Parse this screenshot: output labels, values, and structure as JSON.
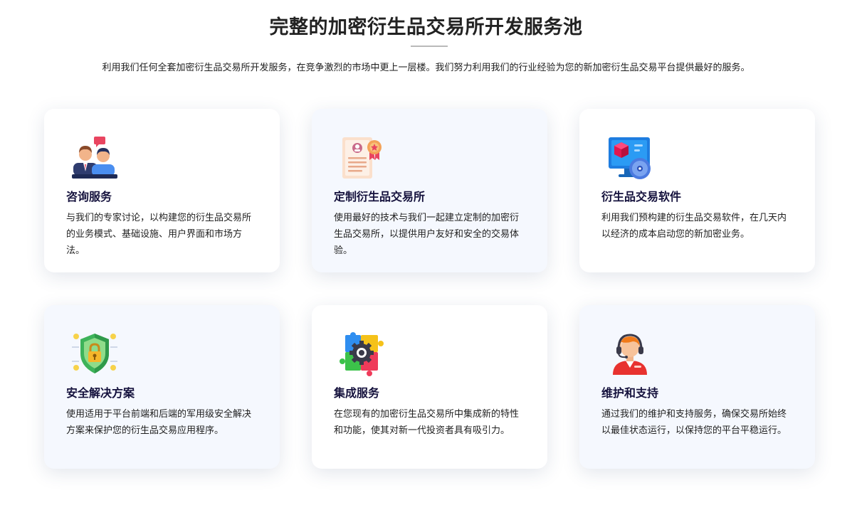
{
  "heading": "完整的加密衍生品交易所开发服务池",
  "intro": "利用我们任何全套加密衍生品交易所开发服务，在竞争激烈的市场中更上一层楼。我们努力利用我们的行业经验为您的新加密衍生品交易平台提供最好的服务。",
  "cards": [
    {
      "icon": "consulting-people-icon",
      "title": "咨询服务",
      "desc": "与我们的专家讨论，以构建您的衍生品交易所的业务模式、基础设施、用户界面和市场方法。"
    },
    {
      "icon": "certificate-badge-icon",
      "title": "定制衍生品交易所",
      "desc": "使用最好的技术与我们一起建立定制的加密衍生品交易所，以提供用户友好和安全的交易体验。"
    },
    {
      "icon": "software-monitor-icon",
      "title": "衍生品交易软件",
      "desc": "利用我们预构建的衍生品交易软件，在几天内以经济的成本启动您的新加密业务。"
    },
    {
      "icon": "security-shield-lock-icon",
      "title": "安全解决方案",
      "desc": "使用适用于平台前端和后端的军用级安全解决方案来保护您的衍生品交易应用程序。"
    },
    {
      "icon": "integration-puzzle-gear-icon",
      "title": "集成服务",
      "desc": "在您现有的加密衍生品交易所中集成新的特性和功能，使其对新一代投资者具有吸引力。"
    },
    {
      "icon": "support-headset-agent-icon",
      "title": "维护和支持",
      "desc": "通过我们的维护和支持服务，确保交易所始终以最佳状态运行，以保持您的平台平稳运行。"
    }
  ]
}
